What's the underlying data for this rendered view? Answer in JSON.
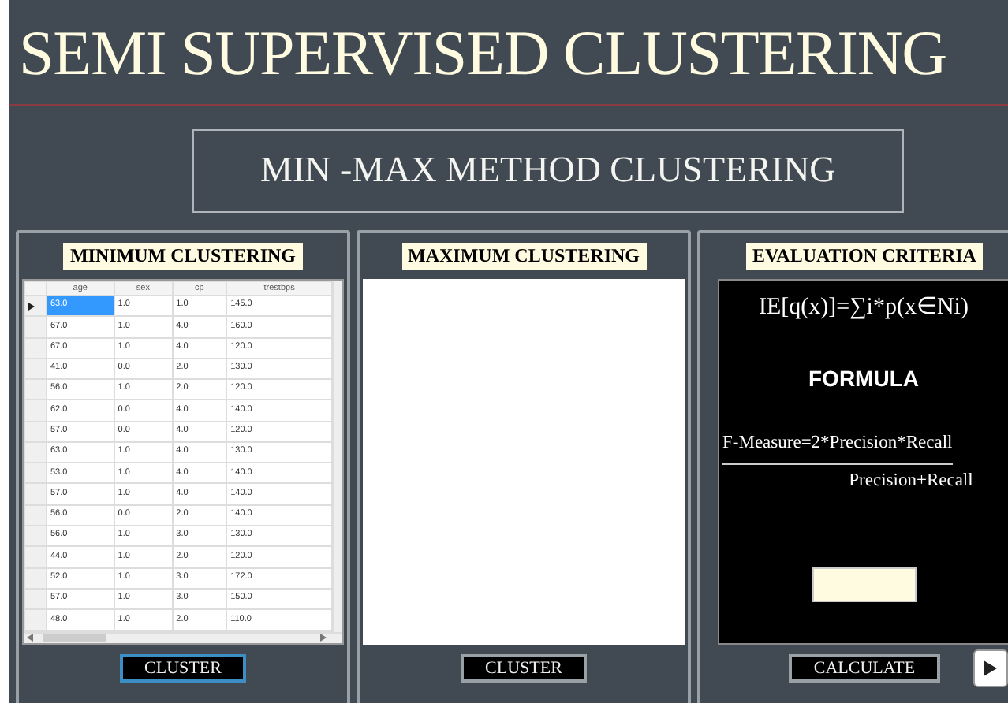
{
  "title": "SEMI SUPERVISED CLUSTERING",
  "subtitle": "MIN -MAX METHOD CLUSTERING",
  "panels": [
    {
      "kind": "table",
      "heading": "MINIMUM CLUSTERING",
      "button": {
        "label": "CLUSTER",
        "focused": true
      },
      "table": {
        "columns": [
          "age",
          "sex",
          "cp",
          "trestbps"
        ],
        "rows": [
          {
            "selected": true,
            "cells": [
              "63.0",
              "1.0",
              "1.0",
              "145.0"
            ]
          },
          {
            "selected": false,
            "cells": [
              "67.0",
              "1.0",
              "4.0",
              "160.0"
            ]
          },
          {
            "selected": false,
            "cells": [
              "67.0",
              "1.0",
              "4.0",
              "120.0"
            ]
          },
          {
            "selected": false,
            "cells": [
              "41.0",
              "0.0",
              "2.0",
              "130.0"
            ]
          },
          {
            "selected": false,
            "cells": [
              "56.0",
              "1.0",
              "2.0",
              "120.0"
            ]
          },
          {
            "selected": false,
            "cells": [
              "62.0",
              "0.0",
              "4.0",
              "140.0"
            ]
          },
          {
            "selected": false,
            "cells": [
              "57.0",
              "0.0",
              "4.0",
              "120.0"
            ]
          },
          {
            "selected": false,
            "cells": [
              "63.0",
              "1.0",
              "4.0",
              "130.0"
            ]
          },
          {
            "selected": false,
            "cells": [
              "53.0",
              "1.0",
              "4.0",
              "140.0"
            ]
          },
          {
            "selected": false,
            "cells": [
              "57.0",
              "1.0",
              "4.0",
              "140.0"
            ]
          },
          {
            "selected": false,
            "cells": [
              "56.0",
              "0.0",
              "2.0",
              "140.0"
            ]
          },
          {
            "selected": false,
            "cells": [
              "56.0",
              "1.0",
              "3.0",
              "130.0"
            ]
          },
          {
            "selected": false,
            "cells": [
              "44.0",
              "1.0",
              "2.0",
              "120.0"
            ]
          },
          {
            "selected": false,
            "cells": [
              "52.0",
              "1.0",
              "3.0",
              "172.0"
            ]
          },
          {
            "selected": false,
            "cells": [
              "57.0",
              "1.0",
              "3.0",
              "150.0"
            ]
          },
          {
            "selected": false,
            "cells": [
              "48.0",
              "1.0",
              "2.0",
              "110.0"
            ]
          }
        ]
      }
    },
    {
      "kind": "empty",
      "heading": "MAXIMUM CLUSTERING",
      "button": {
        "label": "CLUSTER",
        "focused": false
      }
    },
    {
      "kind": "formula",
      "heading": "EVALUATION CRITERIA",
      "button": {
        "label": "CALCULATE",
        "focused": false
      },
      "formula": {
        "expression": "IE[q(x)]=∑i*p(x∈Ni)",
        "caption": "FORMULA",
        "numerator": "F-Measure=2*Precision*Recall",
        "denominator": "Precision+Recall"
      }
    }
  ]
}
